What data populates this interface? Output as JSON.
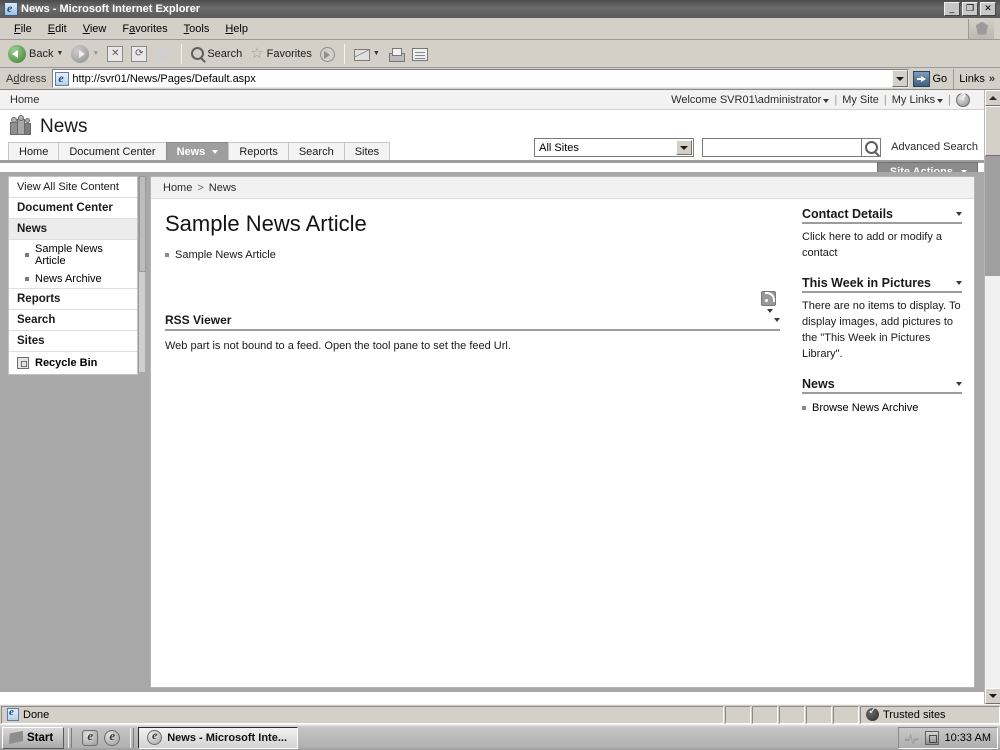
{
  "window": {
    "title": "News - Microsoft Internet Explorer",
    "minimize_label": "_",
    "restore_label": "❐",
    "close_label": "✕"
  },
  "menubar": {
    "items": [
      {
        "label": "File",
        "accel": "F"
      },
      {
        "label": "Edit",
        "accel": "E"
      },
      {
        "label": "View",
        "accel": "V"
      },
      {
        "label": "Favorites",
        "accel": "a"
      },
      {
        "label": "Tools",
        "accel": "T"
      },
      {
        "label": "Help",
        "accel": "H"
      }
    ]
  },
  "toolbar": {
    "back_label": "Back",
    "search_label": "Search",
    "favorites_label": "Favorites",
    "icons": [
      "back-icon",
      "forward-icon",
      "stop-icon",
      "refresh-icon",
      "home-icon",
      "search-icon",
      "favorites-icon",
      "media-icon",
      "mail-icon",
      "print-icon",
      "edit-icon"
    ]
  },
  "address": {
    "label": "Address",
    "url": "http://svr01/News/Pages/Default.aspx",
    "go_label": "Go",
    "links_label": "Links",
    "links_chevron": "»"
  },
  "sharepoint": {
    "globalnav": {
      "home": "Home",
      "welcome": "Welcome SVR01\\administrator",
      "my_site": "My Site",
      "my_links": "My Links",
      "separator": "|"
    },
    "site_title": "News",
    "tabs": [
      {
        "label": "Home",
        "selected": false,
        "has_caret": false
      },
      {
        "label": "Document Center",
        "selected": false,
        "has_caret": false
      },
      {
        "label": "News",
        "selected": true,
        "has_caret": true
      },
      {
        "label": "Reports",
        "selected": false,
        "has_caret": false
      },
      {
        "label": "Search",
        "selected": false,
        "has_caret": false
      },
      {
        "label": "Sites",
        "selected": false,
        "has_caret": false
      }
    ],
    "search": {
      "scope": "All Sites",
      "query": "",
      "placeholder": "",
      "advanced_label": "Advanced Search"
    },
    "site_actions_label": "Site Actions",
    "quicklaunch": [
      {
        "label": "View All Site Content",
        "type": "link"
      },
      {
        "label": "Document Center",
        "type": "heading"
      },
      {
        "label": "News",
        "type": "heading",
        "current": true
      },
      {
        "label": "Sample News Article",
        "type": "sub"
      },
      {
        "label": "News Archive",
        "type": "sub"
      },
      {
        "label": "Reports",
        "type": "heading"
      },
      {
        "label": "Search",
        "type": "heading"
      },
      {
        "label": "Sites",
        "type": "heading"
      },
      {
        "label": "Recycle Bin",
        "type": "recycle"
      }
    ],
    "breadcrumb": {
      "home": "Home",
      "separator": ">",
      "current": "News"
    },
    "article": {
      "title": "Sample News Article",
      "link": "Sample News Article"
    },
    "rss_webpart": {
      "title": "RSS Viewer",
      "body": "Web part is not bound to a feed. Open the tool pane to set the feed Url."
    },
    "right_webparts": [
      {
        "title": "Contact Details",
        "body": "Click here to add or modify a contact",
        "link": ""
      },
      {
        "title": "This Week in Pictures",
        "body": "There are no items to display. To display images, add pictures to the \"This Week in Pictures Library\".",
        "link": ""
      },
      {
        "title": "News",
        "body": "",
        "link": "Browse News Archive"
      }
    ]
  },
  "statusbar": {
    "status": "Done",
    "zone": "Trusted sites"
  },
  "taskbar": {
    "start_label": "Start",
    "tasks": [
      {
        "label": "News - Microsoft Inte..."
      }
    ],
    "clock": "10:33 AM"
  }
}
